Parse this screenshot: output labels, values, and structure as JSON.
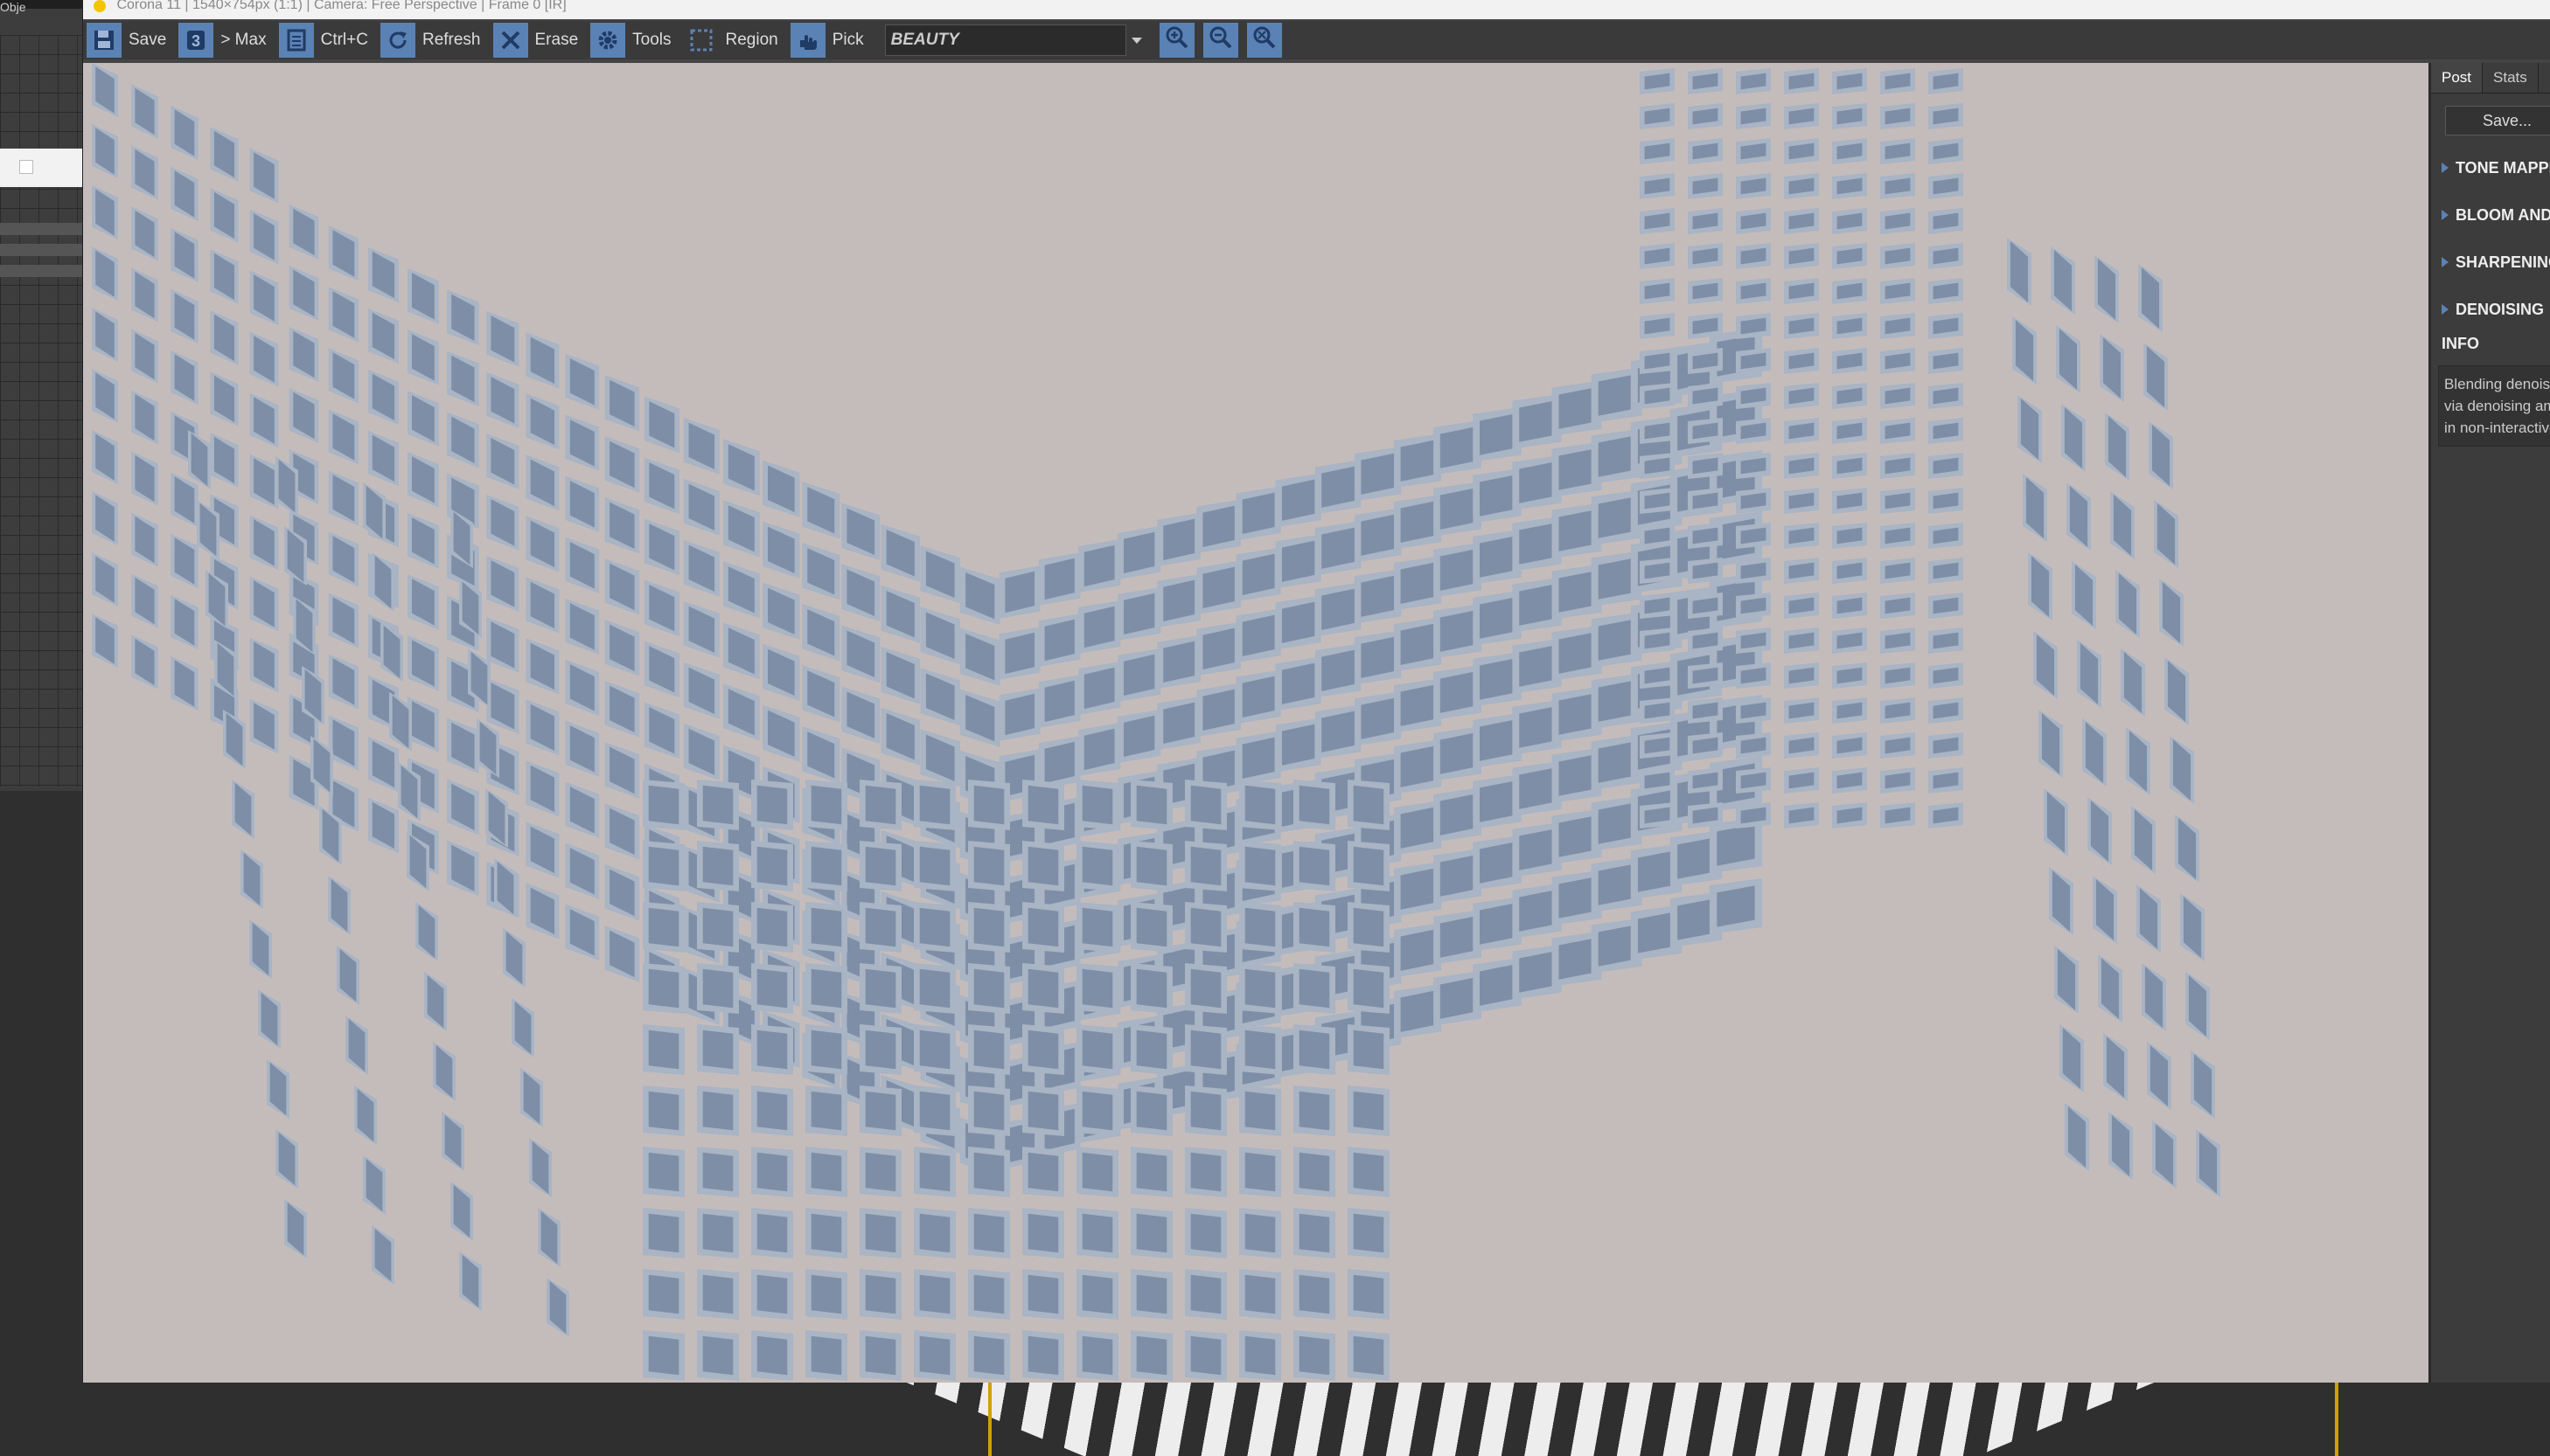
{
  "window_title": "Corona 11 | 1540×754px (1:1) | Camera: Free Perspective | Frame 0 [IR]",
  "background_label": "Obje",
  "toolbar": {
    "save_label": "Save",
    "to_max_label": "> Max",
    "copy_label": "Ctrl+C",
    "refresh_label": "Refresh",
    "erase_label": "Erase",
    "tools_label": "Tools",
    "region_label": "Region",
    "pick_label": "Pick",
    "channel_value": "BEAUTY"
  },
  "post_panel": {
    "tabs": [
      {
        "label": "Post"
      },
      {
        "label": "Stats"
      }
    ],
    "save_button": "Save...",
    "rollouts": [
      {
        "label": "TONE MAPPING"
      },
      {
        "label": "BLOOM AND GLARE"
      },
      {
        "label": "SHARPENING/BLURRING"
      },
      {
        "label": "DENOISING"
      }
    ],
    "info_header": "INFO",
    "info_lines": [
      "Blending denoising",
      "via denoising amount",
      "in non-interactive"
    ]
  },
  "colors": {
    "accent": "#5b82b4",
    "render_background": "#c4bcbb",
    "building_panel": "#7d8ea6",
    "building_frame": "#a9b4c4"
  },
  "icons": {
    "save": "floppy-disk-icon",
    "to_max": "max-logo-icon",
    "copy": "copy-icon",
    "refresh": "refresh-icon",
    "erase": "erase-x-icon",
    "tools": "gear-icon",
    "region": "region-select-icon",
    "pick": "hand-pick-icon",
    "zoom_in": "zoom-in-icon",
    "zoom_out": "zoom-out-icon",
    "zoom_fit": "zoom-fit-icon"
  }
}
